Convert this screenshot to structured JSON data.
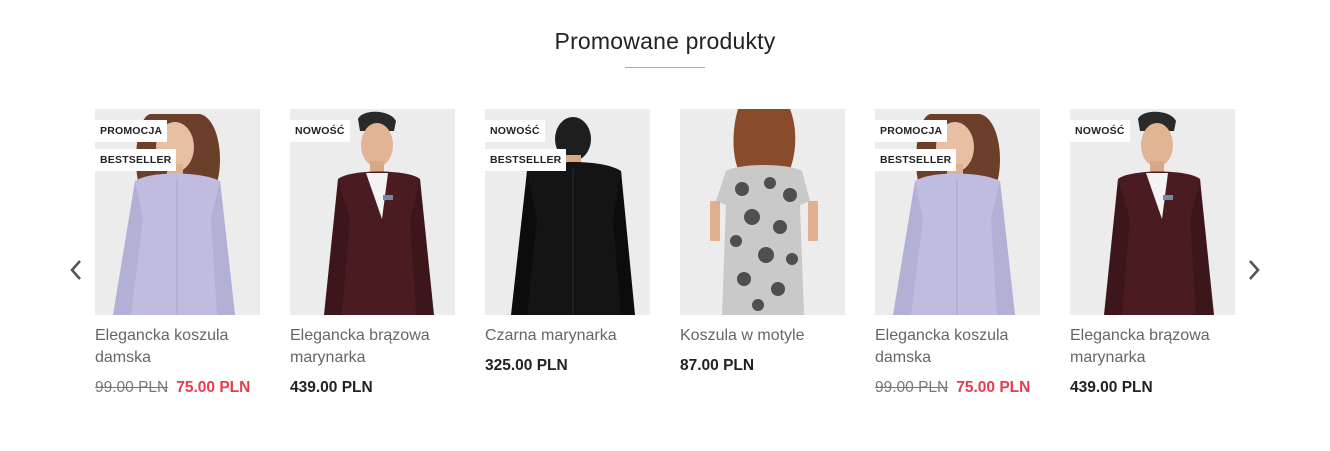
{
  "section": {
    "title": "Promowane produkty"
  },
  "carousel": {
    "prev_icon": "chevron-left-icon",
    "next_icon": "chevron-right-icon"
  },
  "colors": {
    "accent": "#d4a64a",
    "sale": "#e63c4b"
  },
  "products": [
    {
      "name": "Elegancka koszula damska",
      "badges": [
        "PROMOCJA",
        "BESTSELLER"
      ],
      "old_price": "99.00 PLN",
      "price": "75.00 PLN",
      "image": "woman-lavender-shirt"
    },
    {
      "name": "Elegancka brązowa marynarka",
      "badges": [
        "NOWOŚĆ"
      ],
      "price": "439.00 PLN",
      "image": "man-brown-blazer"
    },
    {
      "name": "Czarna marynarka",
      "badges": [
        "NOWOŚĆ",
        "BESTSELLER"
      ],
      "price": "325.00 PLN",
      "image": "man-black-blazer-back"
    },
    {
      "name": "Koszula w motyle",
      "badges": [],
      "price": "87.00 PLN",
      "image": "woman-butterfly-top-back"
    },
    {
      "name": "Elegancka koszula damska",
      "badges": [
        "PROMOCJA",
        "BESTSELLER"
      ],
      "old_price": "99.00 PLN",
      "price": "75.00 PLN",
      "image": "woman-lavender-shirt"
    },
    {
      "name": "Elegancka brązowa marynarka",
      "badges": [
        "NOWOŚĆ"
      ],
      "price": "439.00 PLN",
      "image": "man-brown-blazer"
    }
  ]
}
